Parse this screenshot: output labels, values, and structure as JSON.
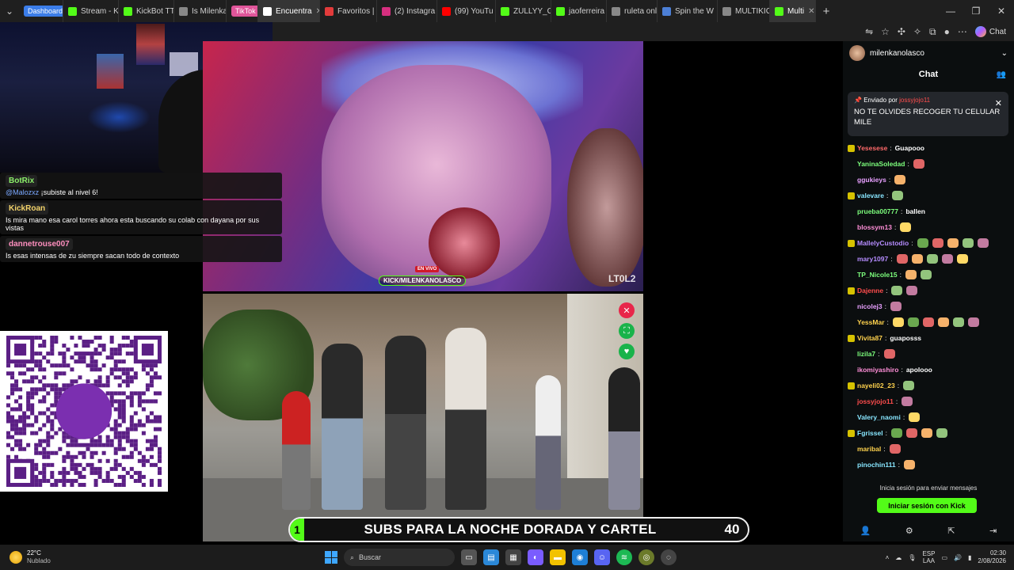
{
  "browser": {
    "tabs": [
      {
        "label": "Dashboard",
        "pill": true,
        "color": "#3b7de9"
      },
      {
        "label": "Stream - Ki",
        "color": "#53fc18"
      },
      {
        "label": "KickBot TT",
        "color": "#53fc18"
      },
      {
        "label": "Is Milenka",
        "color": "#888888"
      },
      {
        "label": "TikTok",
        "pill": true,
        "color": "#e0559a"
      },
      {
        "label": "Encuentra",
        "color": "#ffffff",
        "active": true
      },
      {
        "label": "Favoritos |",
        "color": "#e23b3b"
      },
      {
        "label": "(2) Instagra",
        "color": "#d62f7f"
      },
      {
        "label": "(99) YouTu",
        "color": "#ff0000"
      },
      {
        "label": "ZULLYY_CS",
        "color": "#53fc18"
      },
      {
        "label": "jaoferreira",
        "color": "#53fc18"
      },
      {
        "label": "ruleta onli",
        "color": "#888888"
      },
      {
        "label": "Spin the W",
        "color": "#4c7fd6"
      },
      {
        "label": "MULTIKICK",
        "color": "#888888"
      },
      {
        "label": "Multi",
        "color": "#53fc18",
        "active": true
      }
    ]
  },
  "overlay": {
    "rows": [
      {
        "name": "BotRix",
        "name_color": "#8bf06a",
        "mention": "@Malozxz",
        "text": "¡subiste al nivel 6!"
      },
      {
        "name": "KickRoan",
        "name_color": "#f3d36a",
        "mention": "",
        "text": "Is mira mano esa carol torres ahora esta buscando su colab con dayana por sus vistas"
      },
      {
        "name": "dannetrouse007",
        "name_color": "#ff8fbf",
        "mention": "",
        "text": "Is esas intensas de zu siempre sacan todo de contexto"
      }
    ]
  },
  "stream": {
    "live_tag": "EN VIVO",
    "kick_tag": "KICK/MILENKANOLASCO",
    "watermark": "LT0L2"
  },
  "subs_bar": {
    "lead": "1",
    "text": "SUBS PARA LA NOCHE DORADA Y CARTEL",
    "count": "40"
  },
  "chat": {
    "channel": "milenkanolasco",
    "title": "Chat",
    "pinned_by": "Enviado por",
    "pinned_user": "jossyjojo11",
    "pinned_text": "NO TE OLVIDES RECOGER TU CELULAR MILE",
    "messages": [
      {
        "user": "Yesesese",
        "color": "#ff6a6a",
        "text": "Guapooo",
        "emotes": 0
      },
      {
        "user": "YaninaSoledad",
        "color": "#7dff7d",
        "text": "",
        "emotes": 1
      },
      {
        "user": "ggukieys",
        "color": "#e8a0ff",
        "text": "",
        "emotes": 1
      },
      {
        "user": "valevare",
        "color": "#88e6ff",
        "text": "",
        "emotes": 1
      },
      {
        "user": "prueba00777",
        "color": "#7dff7d",
        "text": "ballen",
        "emotes": 0
      },
      {
        "user": "blossym13",
        "color": "#ff8fd8",
        "text": "",
        "emotes": 1
      },
      {
        "user": "MallelyCustodio",
        "color": "#b58cff",
        "text": "",
        "emotes": 5
      },
      {
        "user": "mary1097",
        "color": "#b58cff",
        "text": "",
        "emotes": 5
      },
      {
        "user": "TP_Nicole15",
        "color": "#7dff7d",
        "text": "",
        "emotes": 2
      },
      {
        "user": "Dajenne",
        "color": "#ff4d4d",
        "text": "",
        "emotes": 2
      },
      {
        "user": "nicolej3",
        "color": "#e8a0ff",
        "text": "",
        "emotes": 1
      },
      {
        "user": "YessMar",
        "color": "#ffd24d",
        "text": "",
        "emotes": 6
      },
      {
        "user": "Vivita87",
        "color": "#ffd24d",
        "text": "guaposss",
        "emotes": 0
      },
      {
        "user": "lizila7",
        "color": "#7dff7d",
        "text": "",
        "emotes": 1
      },
      {
        "user": "ikomiyashiro",
        "color": "#ff8fd8",
        "text": "apolooo",
        "emotes": 0
      },
      {
        "user": "nayeli02_23",
        "color": "#ffd24d",
        "text": "",
        "emotes": 1
      },
      {
        "user": "jossyjojo11",
        "color": "#ff4d4d",
        "text": "",
        "emotes": 1
      },
      {
        "user": "Valery_naomi",
        "color": "#88e6ff",
        "text": "",
        "emotes": 1
      },
      {
        "user": "Fgrissel",
        "color": "#88e6ff",
        "text": "",
        "emotes": 4
      },
      {
        "user": "maribal",
        "color": "#ffd24d",
        "text": "",
        "emotes": 1
      },
      {
        "user": "pinochin111",
        "color": "#88e6ff",
        "text": "",
        "emotes": 1
      }
    ],
    "login_hint": "Inicia sesión para enviar mensajes",
    "login_button": "Iniciar sesión con Kick"
  },
  "taskbar": {
    "temp": "22°C",
    "weather": "Nublado",
    "search_placeholder": "Buscar",
    "lang1": "ESP",
    "lang2": "LAA",
    "time": "02:30",
    "date": "2/08/2026"
  }
}
